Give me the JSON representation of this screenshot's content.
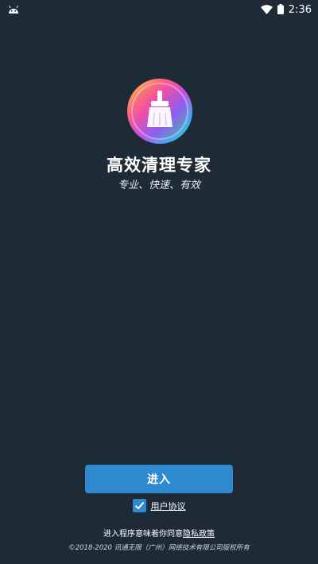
{
  "status_bar": {
    "time": "2:36",
    "left_icon": "android-icon",
    "wifi_icon": "wifi-icon",
    "battery_icon": "battery-icon"
  },
  "app": {
    "icon": "broom-icon",
    "title": "高效清理专家",
    "subtitle": "专业、快速、有效"
  },
  "actions": {
    "enter_label": "进入"
  },
  "agreement": {
    "checked": true,
    "label": "用户协议"
  },
  "footer": {
    "privacy_prefix": "进入程序意味着你同意",
    "privacy_link": "隐私政策",
    "copyright": "©2018-2020 讯通无限（广州）网络技术有限公司版权所有"
  },
  "colors": {
    "background": "#1e2b36",
    "accent": "#2d8ad1"
  }
}
